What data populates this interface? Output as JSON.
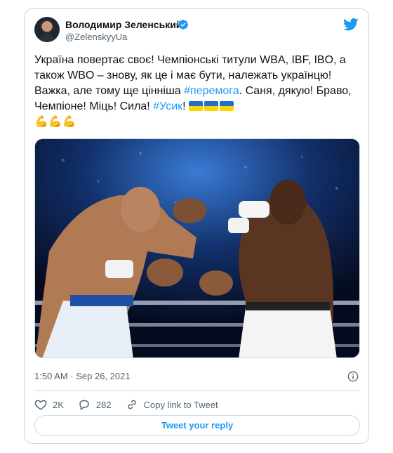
{
  "author": {
    "display_name": "Володимир Зеленський",
    "handle": "@ZelenskyyUa"
  },
  "tweet": {
    "text_part1": "Україна повертає своє! Чемпіонські титули WBA, IBF, IBO, а також WBO – знову, як це і має бути, належать українцю! Важка, але тому ще цінніша ",
    "hashtag1": "#перемога",
    "text_part2": ". Саня, дякую! Браво, Чемпіоне! Міць! Сила! ",
    "hashtag2": "#Усик",
    "text_part3": "! ",
    "emoji_flags": 3,
    "emoji_arms": 3
  },
  "meta": {
    "timestamp": "1:50 AM · Sep 26, 2021"
  },
  "actions": {
    "likes": "2K",
    "replies": "282",
    "copy_link": "Copy link to Tweet"
  },
  "reply_button": "Tweet your reply",
  "icons": [
    "verified-icon",
    "twitter-bird-icon",
    "info-icon",
    "heart-icon",
    "reply-icon",
    "link-icon"
  ],
  "colors": {
    "accent": "#1d9bf0",
    "text": "#0f1419",
    "muted": "#536471",
    "border": "#cfd9de"
  }
}
